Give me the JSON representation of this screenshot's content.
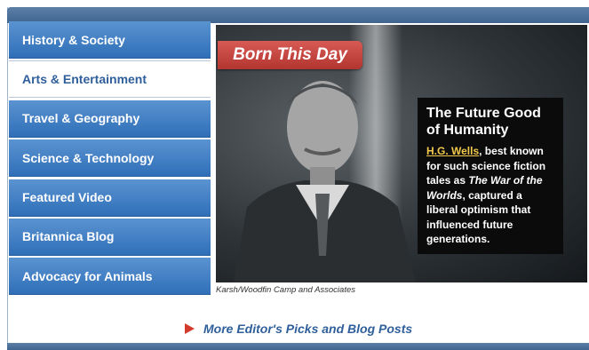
{
  "sidebar": {
    "items": [
      {
        "label": "History & Society"
      },
      {
        "label": "Arts & Entertainment"
      },
      {
        "label": "Travel & Geography"
      },
      {
        "label": "Science & Technology"
      },
      {
        "label": "Featured Video"
      },
      {
        "label": "Britannica Blog"
      },
      {
        "label": "Advocacy for Animals"
      }
    ],
    "active_index": 1
  },
  "feature": {
    "banner": "Born This Day",
    "caption_title": "The Future Good of Humanity",
    "link_text": "H.G. Wells",
    "body_1": ", best known for such science fiction tales as ",
    "body_italic": "The War of the Worlds",
    "body_2": ", captured a liberal optimism that influenced future generations.",
    "credit": "Karsh/Woodfin Camp and Associates"
  },
  "footer": {
    "more_link": "More Editor's Picks and Blog Posts"
  },
  "colors": {
    "nav_blue": "#2f6fb8",
    "accent_red": "#d33b2c",
    "link_gold": "#f2c94c"
  }
}
